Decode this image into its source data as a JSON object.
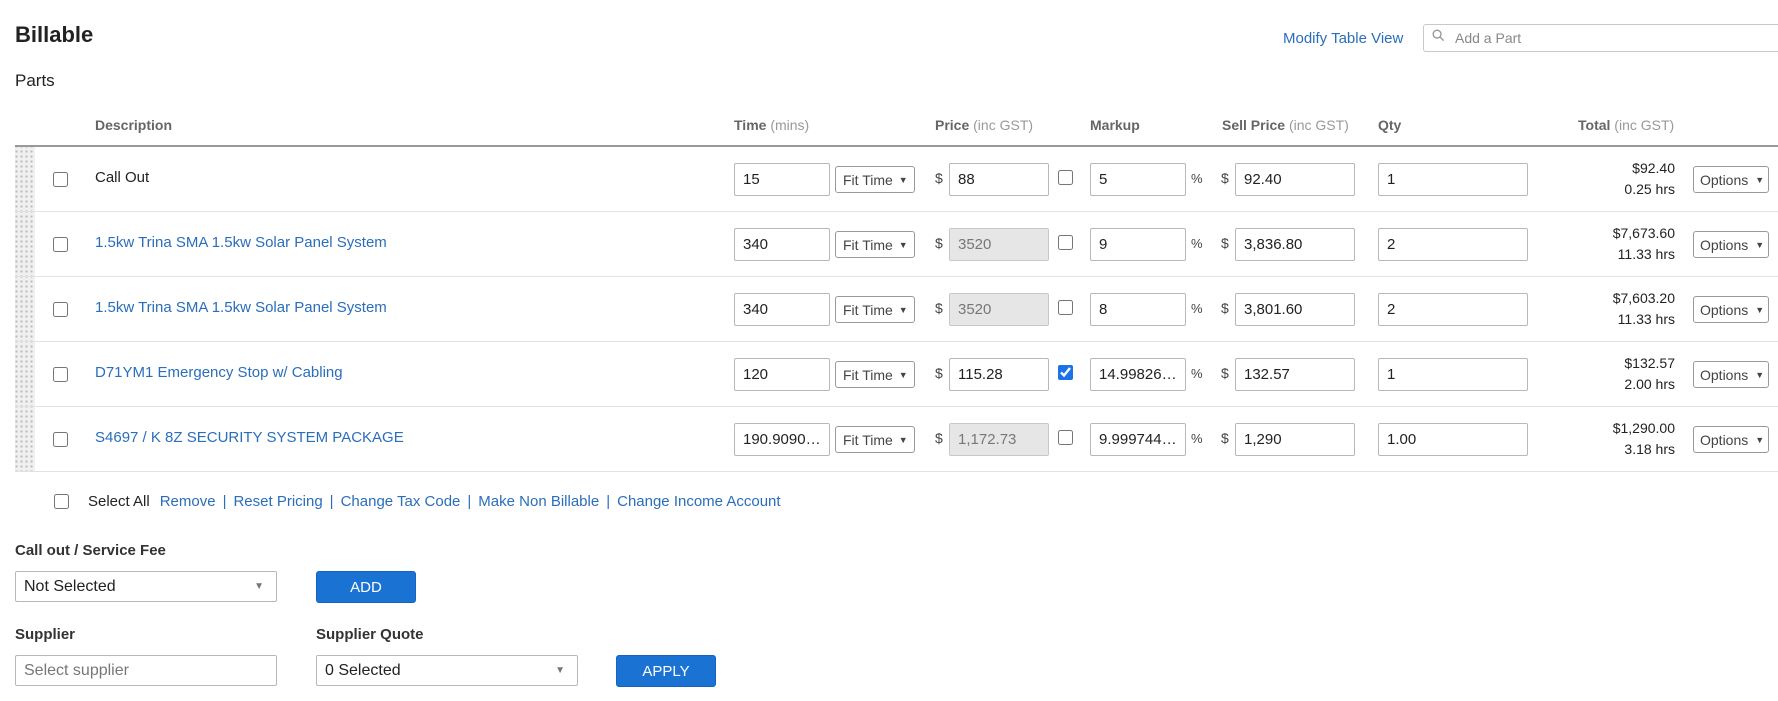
{
  "header": {
    "title": "Billable",
    "subtitle": "Parts",
    "modify_link": "Modify Table View",
    "search_placeholder": "Add a Part"
  },
  "columns": {
    "description": "Description",
    "time": "Time",
    "time_unit": "(mins)",
    "price": "Price",
    "price_unit": "(inc GST)",
    "markup": "Markup",
    "sell_price": "Sell Price",
    "sell_unit": "(inc GST)",
    "qty": "Qty",
    "total": "Total",
    "total_unit": "(inc GST)"
  },
  "common": {
    "fit_label": "Fit Time",
    "currency": "$",
    "percent": "%",
    "options_label": "Options",
    "caret": "▼"
  },
  "rows": [
    {
      "description": "Call Out",
      "is_link": false,
      "time": "15",
      "price": "88",
      "price_disabled": false,
      "price_checked": false,
      "markup": "5",
      "sell": "92.40",
      "qty": "1",
      "total": "$92.40",
      "hours": "0.25 hrs"
    },
    {
      "description": "1.5kw Trina SMA 1.5kw Solar Panel System",
      "is_link": true,
      "time": "340",
      "price": "3520",
      "price_disabled": true,
      "price_checked": false,
      "markup": "9",
      "sell": "3,836.80",
      "qty": "2",
      "total": "$7,673.60",
      "hours": "11.33 hrs"
    },
    {
      "description": "1.5kw Trina SMA 1.5kw Solar Panel System",
      "is_link": true,
      "time": "340",
      "price": "3520",
      "price_disabled": true,
      "price_checked": false,
      "markup": "8",
      "sell": "3,801.60",
      "qty": "2",
      "total": "$7,603.20",
      "hours": "11.33 hrs"
    },
    {
      "description": "D71YM1 Emergency Stop w/ Cabling",
      "is_link": true,
      "time": "120",
      "price": "115.28",
      "price_disabled": false,
      "price_checked": true,
      "markup": "14.99826…",
      "sell": "132.57",
      "qty": "1",
      "total": "$132.57",
      "hours": "2.00 hrs"
    },
    {
      "description": "S4697 / K 8Z SECURITY SYSTEM PACKAGE",
      "is_link": true,
      "time": "190.9090…",
      "price": "1,172.73",
      "price_disabled": true,
      "price_checked": false,
      "markup": "9.999744…",
      "sell": "1,290",
      "qty": "1.00",
      "total": "$1,290.00",
      "hours": "3.18 hrs"
    }
  ],
  "actions": {
    "select_all": "Select All",
    "links": [
      "Remove",
      "Reset Pricing",
      "Change Tax Code",
      "Make Non Billable",
      "Change Income Account"
    ],
    "separator": "|"
  },
  "callout": {
    "label": "Call out / Service Fee",
    "selected": "Not Selected",
    "add_button": "ADD"
  },
  "supplier": {
    "label": "Supplier",
    "placeholder": "Select supplier",
    "quote_label": "Supplier Quote",
    "quote_selected": "0 Selected",
    "apply_button": "APPLY"
  },
  "colors": {
    "link": "#2a6ebb",
    "primary_button": "#1a73d2",
    "disabled_input": "#e6e6e6"
  }
}
